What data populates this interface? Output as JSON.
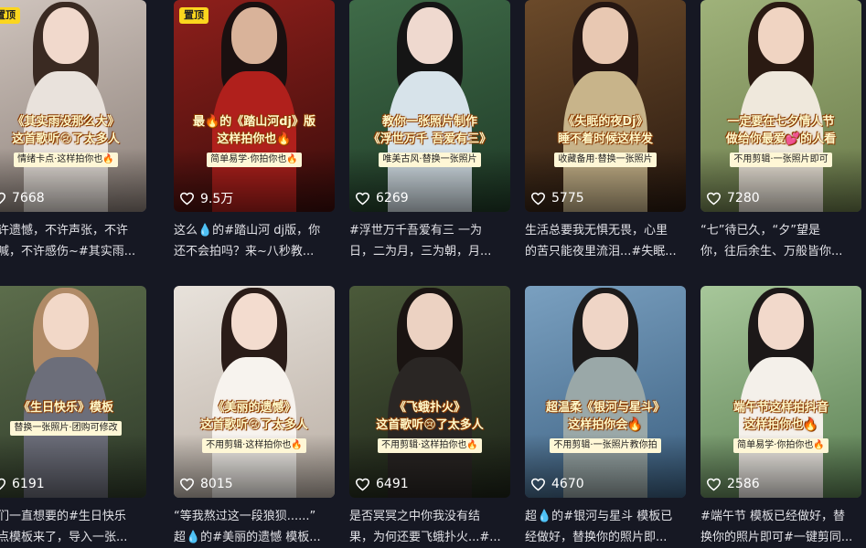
{
  "videos": [
    {
      "pinned": true,
      "pin_label": "置顶",
      "caption": "《其实雨没那么大》\n这首歌听😢了太多人",
      "tag": "情绪卡点·这样拍你也🔥",
      "likes": "7668",
      "desc1": "不许遗憾，不许声张，不许",
      "desc2": "哭喊，不许感伤~#其实雨...",
      "colors": {
        "bg1": "#cfc4bd",
        "bg2": "#8c8079",
        "hair": "#3a2a22",
        "skin": "#f1d9cc",
        "body": "#e9e2dc"
      }
    },
    {
      "pinned": true,
      "pin_label": "置顶",
      "caption": "最🔥的《踏山河dj》版\n这样拍你也🔥",
      "tag": "简单易学·你拍你也🔥",
      "likes": "9.5万",
      "desc1": "这么💧的#踏山河 dj版，你",
      "desc2": "还不会拍吗？来~八秒教...",
      "colors": {
        "bg1": "#8e1f1b",
        "bg2": "#3b0d0b",
        "hair": "#1a1010",
        "skin": "#d9b39a",
        "body": "#b0201c"
      }
    },
    {
      "pinned": false,
      "caption": "教你一张照片制作\n《浮世万千 吾爱有三》",
      "tag": "唯美古风·替换一张照片",
      "likes": "6269",
      "desc1": "#浮世万千吾爱有三 一为",
      "desc2": "日，二为月，三为朝，月...",
      "colors": {
        "bg1": "#3f6b48",
        "bg2": "#1f3a27",
        "hair": "#151515",
        "skin": "#efd9cf",
        "body": "#d7e3ea"
      }
    },
    {
      "pinned": false,
      "caption": "《失眠的夜Dj》\n睡不着时候这样发",
      "tag": "收藏备用·替换一张照片",
      "likes": "5775",
      "desc1": "生活总要我无惧无畏，心里",
      "desc2": "的苦只能夜里流泪...#失眠...",
      "colors": {
        "bg1": "#6b4a2a",
        "bg2": "#2a1a10",
        "hair": "#241612",
        "skin": "#e8c8b2",
        "body": "#c8b48a"
      }
    },
    {
      "pinned": false,
      "caption": "一定要在七夕情人节\n做给你最爱💕的人看",
      "tag": "不用剪辑·一张照片即可",
      "likes": "7280",
      "desc1": "“七”待已久，“夕”望是",
      "desc2": "你，往后余生、万般皆你...",
      "colors": {
        "bg1": "#9fb27a",
        "bg2": "#6a7a4a",
        "hair": "#2a1a12",
        "skin": "#f0d4c2",
        "body": "#efe8dc"
      }
    },
    {
      "pinned": false,
      "caption": "《生日快乐》模板",
      "tag": "替换一张照片·团购可修改",
      "likes": "6191",
      "desc1": "你们一直想要的#生日快乐",
      "desc2": "卡点模板来了，导入一张...",
      "colors": {
        "bg1": "#5d6e4c",
        "bg2": "#2f3b2a",
        "hair": "#b08a66",
        "skin": "#f2d8c8",
        "body": "#6c6e7a"
      }
    },
    {
      "pinned": false,
      "caption": "《美丽的遗憾》\n这首歌听😢了太多人",
      "tag": "不用剪辑·这样拍你也🔥",
      "likes": "8015",
      "desc1": "“等我熬过这一段狼狈......”",
      "desc2": "超💧的#美丽的遗憾 模板...",
      "colors": {
        "bg1": "#e8e2db",
        "bg2": "#b9aea4",
        "hair": "#2a1c18",
        "skin": "#f3dccf",
        "body": "#f7f3ee"
      }
    },
    {
      "pinned": false,
      "caption": "《飞蛾扑火》\n这首歌听😢了太多人",
      "tag": "不用剪辑·这样拍你也🔥",
      "likes": "6491",
      "desc1": "是否冥冥之中你我没有结",
      "desc2": "果，为何还要飞蛾扑火...#...",
      "colors": {
        "bg1": "#4b5a3a",
        "bg2": "#1d2318",
        "hair": "#1a1412",
        "skin": "#ecd2c2",
        "body": "#2a2624"
      }
    },
    {
      "pinned": false,
      "caption": "超温柔《银河与星斗》\n这样拍你会🔥",
      "tag": "不用剪辑·一张照片教你拍",
      "likes": "4670",
      "desc1": "超💧的#银河与星斗 模板已",
      "desc2": "经做好，替换你的照片即...",
      "colors": {
        "bg1": "#7aa0c0",
        "bg2": "#3b5f80",
        "hair": "#1c1a1a",
        "skin": "#efd5c6",
        "body": "#9aa8a8"
      }
    },
    {
      "pinned": false,
      "caption": "端午节这样拍抖音\n这样拍你也🔥",
      "tag": "简单易学·你拍你也🔥",
      "likes": "2586",
      "desc1": "#端午节 模板已经做好，替",
      "desc2": "换你的照片即可#一键剪同...",
      "colors": {
        "bg1": "#a7c79a",
        "bg2": "#5a7e52",
        "hair": "#1c1818",
        "skin": "#f2d9cb",
        "body": "#f4f0ea"
      }
    }
  ]
}
